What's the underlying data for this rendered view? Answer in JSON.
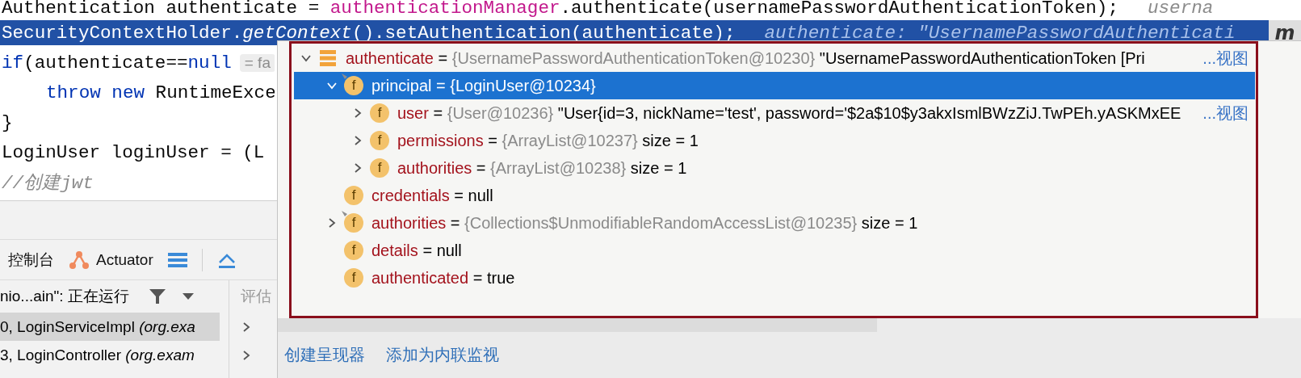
{
  "editor": {
    "lines": [
      {
        "highlighted": false,
        "indented": false,
        "tokens": [
          {
            "kind": "plain",
            "text": "Authentication authenticate = "
          },
          {
            "kind": "field",
            "text": "authenticationManager"
          },
          {
            "kind": "plain",
            "text": ".authenticate(usernamePasswordAuthenticationToken);"
          }
        ],
        "hint": {
          "kind": "hint",
          "text": "userna"
        }
      },
      {
        "highlighted": true,
        "indented": false,
        "tokens": [
          {
            "kind": "plain",
            "text": "SecurityContextHolder."
          },
          {
            "kind": "method",
            "text": "getContext"
          },
          {
            "kind": "plain",
            "text": "().setAuthentication(authenticate);"
          }
        ],
        "hint": {
          "kind": "hint",
          "text": "authenticate: \"UsernamePasswordAuthenticati"
        }
      },
      {
        "highlighted": false,
        "indented": false,
        "tokens": [
          {
            "kind": "keyword",
            "text": "if"
          },
          {
            "kind": "plain",
            "text": "(authenticate=="
          },
          {
            "kind": "keyword",
            "text": "null"
          }
        ],
        "hint": {
          "kind": "pill",
          "text": "= fa"
        }
      },
      {
        "highlighted": false,
        "indented": true,
        "tokens": [
          {
            "kind": "keyword",
            "text": "throw new"
          },
          {
            "kind": "plain",
            "text": " RuntimeExce"
          }
        ]
      },
      {
        "highlighted": false,
        "indented": false,
        "tokens": [
          {
            "kind": "plain",
            "text": "}"
          }
        ]
      },
      {
        "highlighted": false,
        "indented": false,
        "tokens": [
          {
            "kind": "plain",
            "text": "LoginUser loginUser = (L"
          }
        ]
      },
      {
        "highlighted": false,
        "indented": false,
        "tokens": [
          {
            "kind": "comment",
            "text": "//创建jwt"
          }
        ]
      }
    ],
    "badge": "m"
  },
  "debugger": {
    "tabs": [
      {
        "label": "控制台"
      },
      {
        "label": "Actuator"
      }
    ],
    "thread": "nio...ain\": 正在运行",
    "evaluate": {
      "placeholder": "评估"
    },
    "frames": [
      {
        "text": "0, LoginServiceImpl *(org.exa*",
        "selected": true
      },
      {
        "text": "3, LoginController *(org.exam*",
        "selected": false
      }
    ]
  },
  "popup": {
    "tree": [
      {
        "name": "authenticate",
        "sep": "=",
        "type": "{UsernamePasswordAuthenticationToken@10230}",
        "value": "\"UsernamePasswordAuthenticationToken [Pri",
        "kind": "object",
        "expanded": true,
        "selected": false,
        "flagged": false,
        "link": "...视图",
        "children": [
          {
            "name": "principal",
            "sep": "=",
            "type": "{LoginUser@10234}",
            "kind": "field",
            "badge": "f",
            "expanded": true,
            "selected": true,
            "flagged": true,
            "children": [
              {
                "name": "user",
                "sep": "=",
                "type": "{User@10236}",
                "value": "\"User{id=3, nickName='test', password='$2a$10$y3akxIsmlBWzZiJ.TwPEh.yASKMxEE",
                "kind": "field",
                "badge": "f",
                "expanded": false,
                "selected": false,
                "flagged": false,
                "link": "...视图"
              },
              {
                "name": "permissions",
                "sep": "=",
                "type": "{ArrayList@10237}",
                "value": "size = 1",
                "kind": "field",
                "badge": "f",
                "expanded": false,
                "selected": false,
                "flagged": false
              },
              {
                "name": "authorities",
                "sep": "=",
                "type": "{ArrayList@10238}",
                "value": "size = 1",
                "kind": "field",
                "badge": "f",
                "expanded": false,
                "selected": false,
                "flagged": false
              }
            ]
          },
          {
            "name": "credentials",
            "sep": "=",
            "value": "null",
            "kind": "field",
            "badge": "f",
            "selected": false,
            "flagged": false
          },
          {
            "name": "authorities",
            "sep": "=",
            "type": "{Collections$UnmodifiableRandomAccessList@10235}",
            "value": "size = 1",
            "kind": "field",
            "badge": "f",
            "expanded": false,
            "selected": false,
            "flagged": true
          },
          {
            "name": "details",
            "sep": "=",
            "value": "null",
            "kind": "field",
            "badge": "f",
            "selected": false,
            "flagged": false
          },
          {
            "name": "authenticated",
            "sep": "=",
            "value": "true",
            "kind": "field",
            "badge": "f",
            "selected": false,
            "flagged": false
          }
        ]
      }
    ],
    "links": [
      "创建呈现器",
      "添加为内联监视"
    ]
  }
}
